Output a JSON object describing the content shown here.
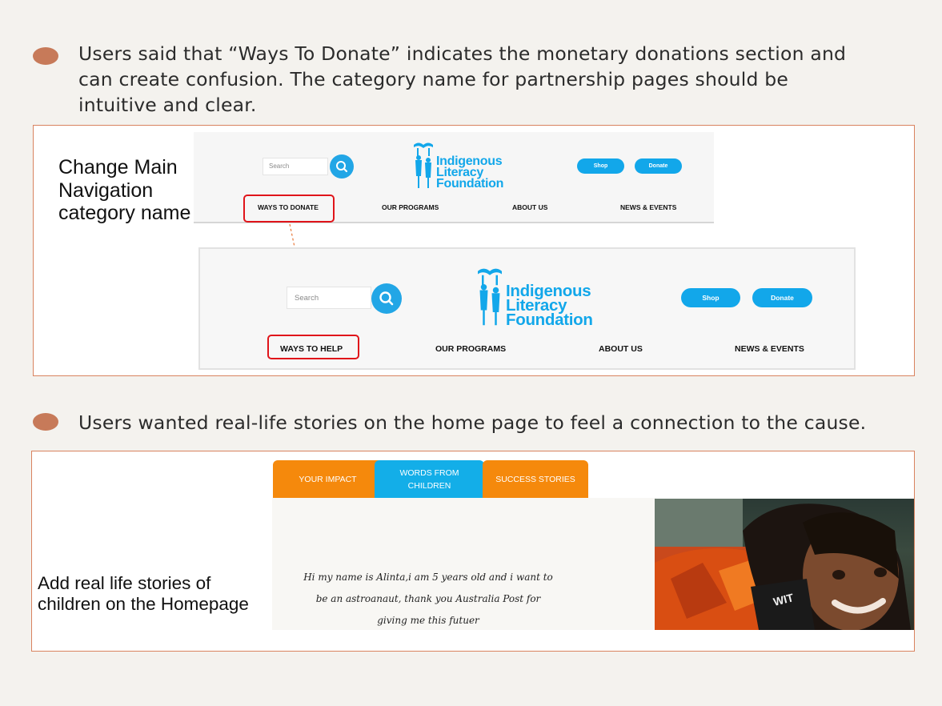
{
  "insights": [
    {
      "text": "Users said that “Ways To Donate”  indicates the monetary donations section and can create confusion.  The category name for partnership pages should be intuitive and clear."
    },
    {
      "text": "Users wanted real-life stories on the home page to feel a connection to the cause."
    }
  ],
  "change_nav": {
    "label": "Change Main Navigation category name",
    "before": {
      "search_placeholder": "Search",
      "logo_lines": [
        "Indigenous",
        "Literacy",
        "Foundation"
      ],
      "shop": "Shop",
      "donate": "Donate",
      "nav": [
        "WAYS TO DONATE",
        "OUR PROGRAMS",
        "ABOUT US",
        "NEWS & EVENTS"
      ]
    },
    "after": {
      "search_placeholder": "Search",
      "logo_lines": [
        "Indigenous",
        "Literacy",
        "Foundation"
      ],
      "shop": "Shop",
      "donate": "Donate",
      "nav": [
        "WAYS TO HELP",
        "OUR PROGRAMS",
        "ABOUT US",
        "NEWS & EVENTS"
      ]
    }
  },
  "stories": {
    "label": "Add real life stories of children on the Homepage",
    "tabs": [
      "YOUR IMPACT",
      "WORDS FROM CHILDREN",
      "SUCCESS STORIES"
    ],
    "story_text": "Hi my name is Alinta,i am 5 years old and i want to be an astroanaut, thank you Australia Post for giving me this futuer",
    "photo_shirt_text": "WIT"
  },
  "colors": {
    "background": "#f4f2ee",
    "bullet": "#c77a59",
    "box_border": "#d9835f",
    "brand_blue": "#12a7ea",
    "tab_orange": "#f5890c",
    "tab_blue": "#13aee8",
    "highlight_red": "#e0141a"
  }
}
